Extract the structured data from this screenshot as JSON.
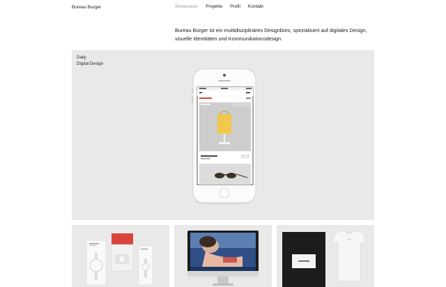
{
  "header": {
    "logo": "Bureau Burger",
    "nav": [
      {
        "label": "Showcases",
        "active": true
      },
      {
        "label": "Projekte",
        "active": false
      },
      {
        "label": "Profil",
        "active": false
      },
      {
        "label": "Kontakt",
        "active": false
      }
    ]
  },
  "intro": "Bureau Burger ist ein multidisziplinäres Designbüro, spezialisiert auf digitales Design, visuelle Identitäten und Kommunikationsdesign.",
  "hero": {
    "label_line1": "Daily",
    "label_line2": "Digital Design",
    "phone_screen": {
      "title": "Collection",
      "product_name": "Tomate Large Nylon"
    }
  },
  "colors": {
    "background": "#ffffff",
    "tile_gray": "#e9e9e9",
    "nav_active": "#9a9a9a",
    "accent_red": "#d9443a",
    "bag_yellow": "#f2c84b"
  }
}
